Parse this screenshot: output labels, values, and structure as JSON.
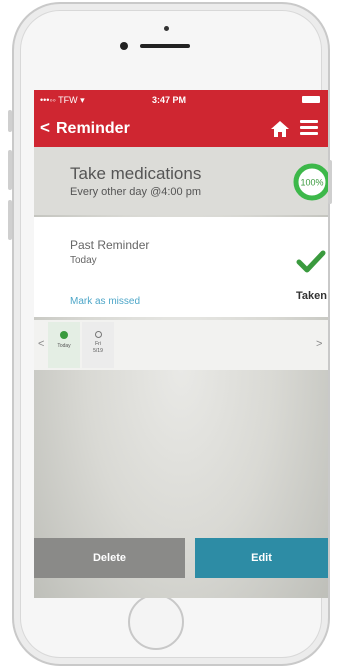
{
  "status_bar": {
    "carrier": "•••◦◦ TFW ▾",
    "time": "3:47 PM"
  },
  "nav": {
    "back_icon": "chevron-left-icon",
    "title": "Reminder",
    "home_icon": "home-icon",
    "menu_icon": "hamburger-menu-icon"
  },
  "medication": {
    "title": "Take medications",
    "schedule": "Every other day @4:00 pm",
    "progress_label": "100%",
    "progress_value": 1.0
  },
  "reminder": {
    "heading": "Past Reminder",
    "day": "Today",
    "mark_missed": "Mark as missed",
    "status": "Taken"
  },
  "date_strip": {
    "days": [
      {
        "label": "Today",
        "sub": ""
      },
      {
        "label": "Fri",
        "sub": "5/19"
      }
    ]
  },
  "actions": {
    "delete": "Delete",
    "edit": "Edit"
  },
  "colors": {
    "brand_red": "#cf2631",
    "success_green": "#3a9a3e",
    "edit_teal": "#2d8ca5",
    "delete_gray": "#8a8a88"
  }
}
